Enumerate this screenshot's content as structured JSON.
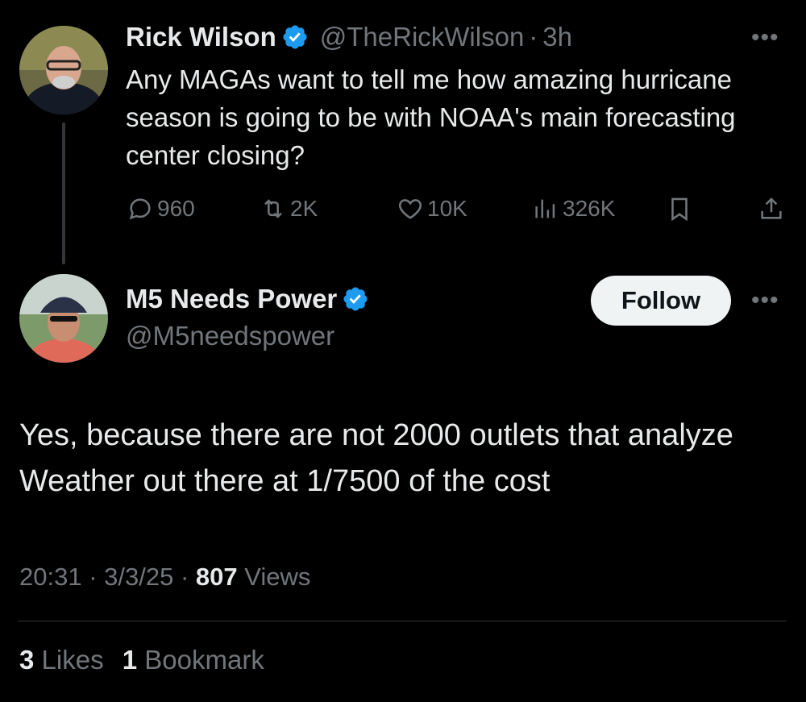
{
  "original_tweet": {
    "author_name": "Rick Wilson",
    "handle": "@TheRickWilson",
    "time": "3h",
    "text": "Any MAGAs want to tell me how amazing hurricane season is going to be with NOAA's main forecasting center closing?",
    "replies": "960",
    "reposts": "2K",
    "likes": "10K",
    "views": "326K"
  },
  "reply": {
    "author_name": "M5 Needs Power",
    "handle": "@M5needspower",
    "follow_label": "Follow",
    "text": "Yes, because there are not 2000 outlets that analyze Weather out there at 1/7500 of the cost",
    "time": "20:31",
    "date": "3/3/25",
    "views_count": "807",
    "views_label": "Views",
    "likes_count": "3",
    "likes_label": "Likes",
    "bookmarks_count": "1",
    "bookmarks_label": "Bookmark"
  },
  "colors": {
    "background": "#000000",
    "text": "#e7e9ea",
    "muted": "#71767b",
    "verified": "#1d9bf0"
  },
  "icons": [
    "reply-icon",
    "repost-icon",
    "like-icon",
    "views-icon",
    "bookmark-icon",
    "share-icon",
    "verified-badge-icon",
    "more-icon"
  ]
}
